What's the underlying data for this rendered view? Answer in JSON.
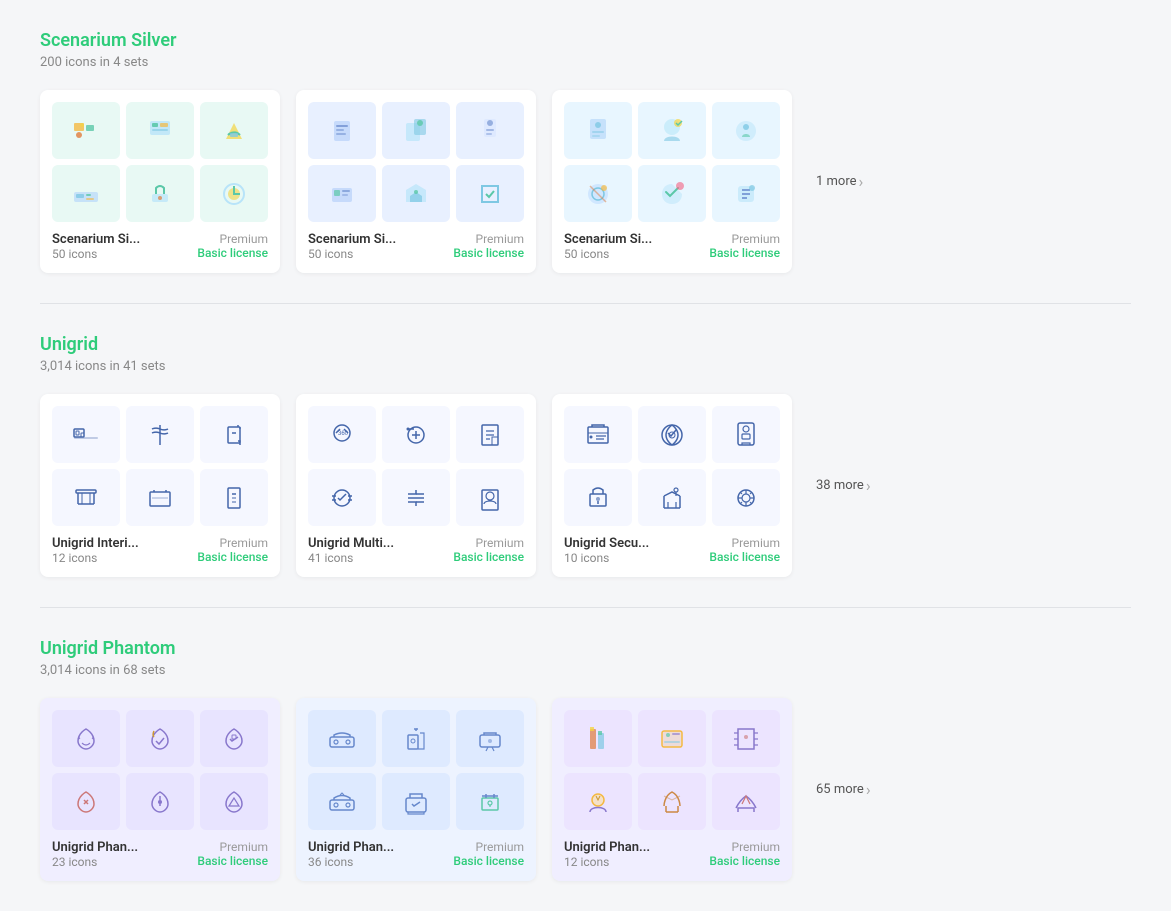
{
  "sections": [
    {
      "id": "scenarium-silver",
      "title": "Scenarium Silver",
      "subtitle": "200 icons in 4 sets",
      "more_count": "1 more",
      "color": "#2ecc7a",
      "sets": [
        {
          "name": "Scenarium Si...",
          "count": "50 icons",
          "license": "Basic license",
          "tier": "Premium",
          "style": "scenarium"
        },
        {
          "name": "Scenarium Si...",
          "count": "50 icons",
          "license": "Basic license",
          "tier": "Premium",
          "style": "scenarium"
        },
        {
          "name": "Scenarium Si...",
          "count": "50 icons",
          "license": "Basic license",
          "tier": "Premium",
          "style": "scenarium"
        }
      ]
    },
    {
      "id": "unigrid",
      "title": "Unigrid",
      "subtitle": "3,014 icons in 41 sets",
      "more_count": "38 more",
      "color": "#2ecc7a",
      "sets": [
        {
          "name": "Unigrid Interi...",
          "count": "12 icons",
          "license": "Basic license",
          "tier": "Premium",
          "style": "unigrid"
        },
        {
          "name": "Unigrid Multi...",
          "count": "41 icons",
          "license": "Basic license",
          "tier": "Premium",
          "style": "unigrid"
        },
        {
          "name": "Unigrid Secu...",
          "count": "10 icons",
          "license": "Basic license",
          "tier": "Premium",
          "style": "unigrid"
        }
      ]
    },
    {
      "id": "unigrid-phantom",
      "title": "Unigrid Phantom",
      "subtitle": "3,014 icons in 68 sets",
      "more_count": "65 more",
      "color": "#2ecc7a",
      "sets": [
        {
          "name": "Unigrid Phan...",
          "count": "23 icons",
          "license": "Basic license",
          "tier": "Premium",
          "style": "phantom"
        },
        {
          "name": "Unigrid Phan...",
          "count": "36 icons",
          "license": "Basic license",
          "tier": "Premium",
          "style": "phantom"
        },
        {
          "name": "Unigrid Phan...",
          "count": "12 icons",
          "license": "Basic license",
          "tier": "Premium",
          "style": "phantom"
        }
      ]
    }
  ]
}
